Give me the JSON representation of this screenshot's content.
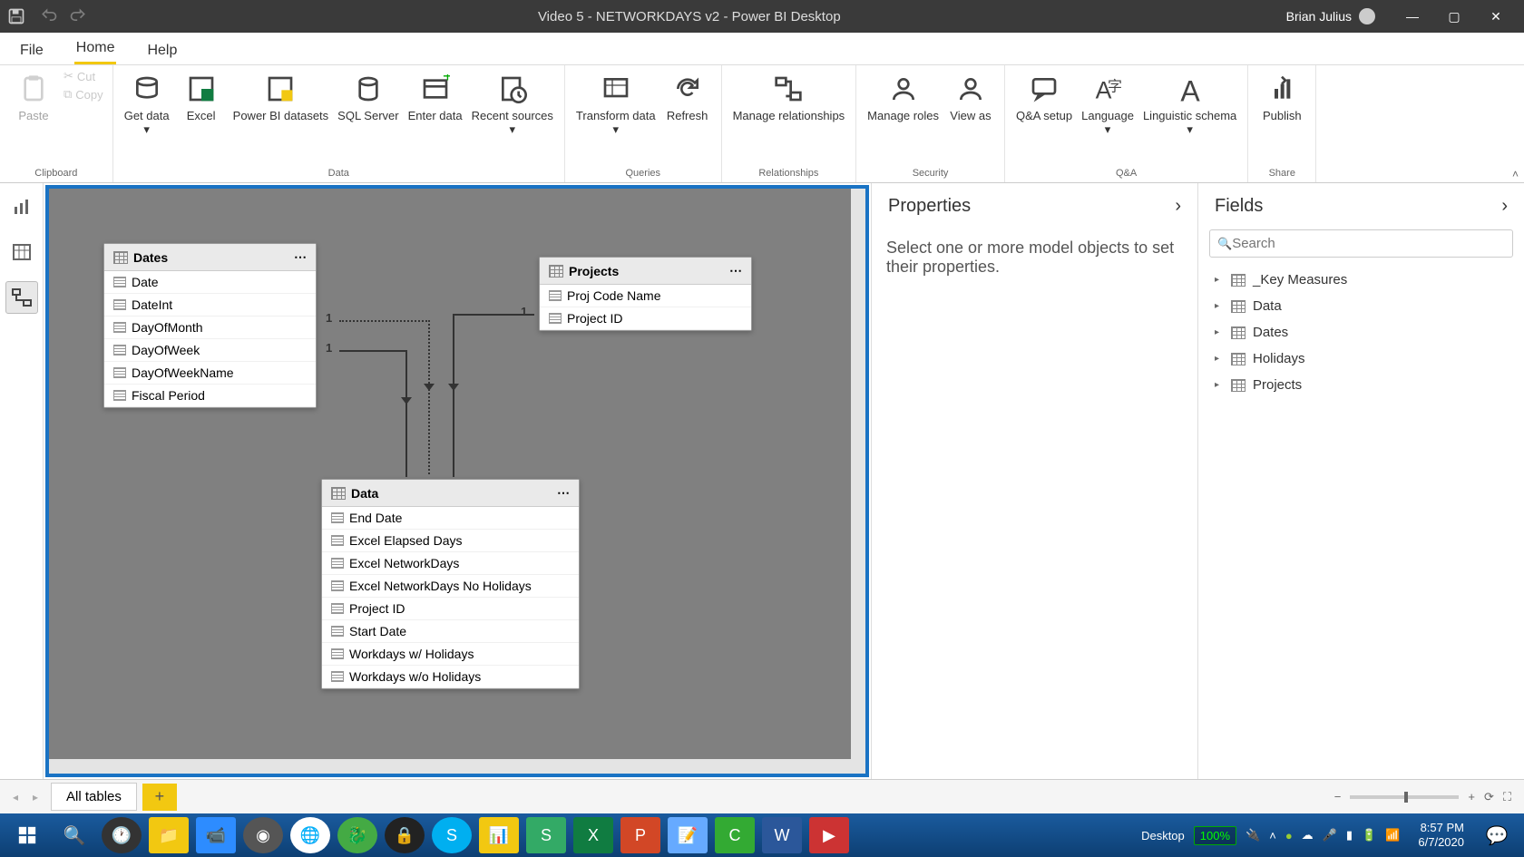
{
  "titlebar": {
    "title": "Video 5 - NETWORKDAYS v2 - Power BI Desktop",
    "user": "Brian Julius"
  },
  "tabs": {
    "file": "File",
    "home": "Home",
    "help": "Help"
  },
  "ribbon": {
    "clipboard": {
      "paste": "Paste",
      "cut": "Cut",
      "copy": "Copy",
      "label": "Clipboard"
    },
    "data": {
      "get": "Get data",
      "excel": "Excel",
      "pbi": "Power BI datasets",
      "sql": "SQL Server",
      "enter": "Enter data",
      "recent": "Recent sources",
      "label": "Data"
    },
    "queries": {
      "transform": "Transform data",
      "refresh": "Refresh",
      "label": "Queries"
    },
    "relationships": {
      "manage": "Manage relationships",
      "label": "Relationships"
    },
    "security": {
      "roles": "Manage roles",
      "viewas": "View as",
      "label": "Security"
    },
    "qa": {
      "setup": "Q&A setup",
      "lang": "Language",
      "schema": "Linguistic schema",
      "label": "Q&A"
    },
    "share": {
      "publish": "Publish",
      "label": "Share"
    }
  },
  "tables": {
    "dates": {
      "name": "Dates",
      "fields": [
        "Date",
        "DateInt",
        "DayOfMonth",
        "DayOfWeek",
        "DayOfWeekName",
        "Fiscal Period"
      ]
    },
    "projects": {
      "name": "Projects",
      "fields": [
        "Proj Code Name",
        "Project ID"
      ]
    },
    "data": {
      "name": "Data",
      "fields": [
        "End Date",
        "Excel Elapsed Days",
        "Excel NetworkDays",
        "Excel NetworkDays No Holidays",
        "Project ID",
        "Start Date",
        "Workdays w/ Holidays",
        "Workdays w/o Holidays"
      ]
    }
  },
  "properties": {
    "title": "Properties",
    "empty": "Select one or more model objects to set their properties."
  },
  "fields": {
    "title": "Fields",
    "search_placeholder": "Search",
    "items": [
      "_Key Measures",
      "Data",
      "Dates",
      "Holidays",
      "Projects"
    ]
  },
  "bottom": {
    "all_tables": "All tables"
  },
  "taskbar": {
    "desktop": "Desktop",
    "battery": "100%",
    "time": "8:57 PM",
    "date": "6/7/2020"
  },
  "rel": {
    "one": "1"
  }
}
